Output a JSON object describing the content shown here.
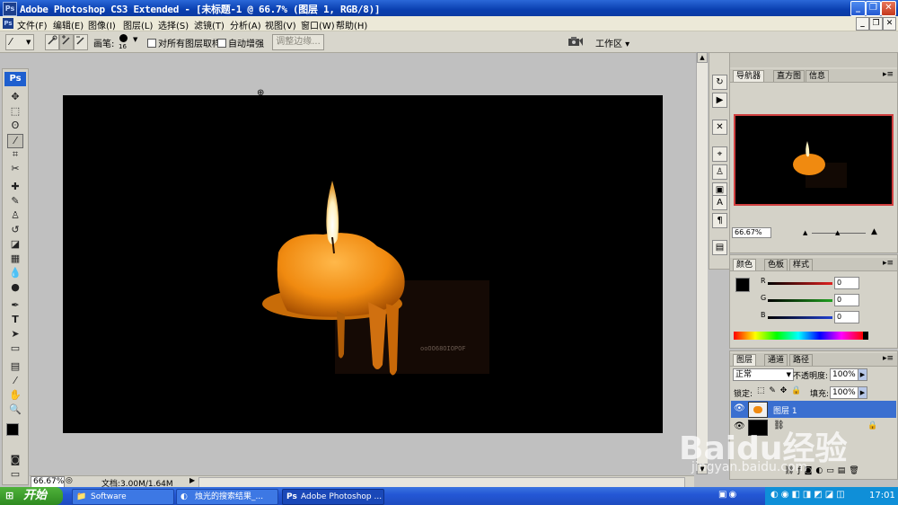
{
  "window": {
    "title": "Adobe Photoshop CS3 Extended - [未标题-1 @ 66.7% (图层 1, RGB/8)]",
    "app_icon": "Ps",
    "buttons": {
      "minimize": "_",
      "restore": "❐",
      "close": "✕"
    }
  },
  "menu": {
    "items": [
      "文件(F)",
      "编辑(E)",
      "图像(I)",
      "图层(L)",
      "选择(S)",
      "滤镜(T)",
      "分析(A)",
      "视图(V)",
      "窗口(W)",
      "帮助(H)"
    ],
    "doc_buttons": {
      "minimize": "_",
      "restore": "❐",
      "close": "✕"
    }
  },
  "options": {
    "brush_label": "画笔:",
    "brush_size": "16",
    "sample_all_layers": "对所有图层取样",
    "auto_enhance": "自动增强",
    "refine_edge": "调整边缘...",
    "workspace": "工作区 ▾"
  },
  "toolbox": {
    "logo": "Ps",
    "tools": [
      "move",
      "marquee",
      "lasso",
      "quick-selection",
      "crop",
      "slice",
      "healing",
      "brush",
      "stamp",
      "history-brush",
      "eraser",
      "gradient",
      "blur",
      "dodge",
      "pen",
      "type",
      "path-select",
      "shape",
      "notes",
      "eyedropper",
      "hand",
      "zoom"
    ],
    "selected_tool": "quick-selection"
  },
  "canvas": {
    "watermark_text": "Baidu经验",
    "watermark_sub": "jingyan.baidu.com"
  },
  "status": {
    "zoom": "66.67%",
    "doc_info": "文档:3.00M/1.64M"
  },
  "navigator": {
    "tabs": [
      "导航器",
      "直方图",
      "信息"
    ],
    "zoom": "66.67%"
  },
  "color_panel": {
    "tabs": [
      "颜色",
      "色板",
      "样式"
    ],
    "channels": [
      {
        "label": "R",
        "value": "0",
        "color": "#e02020"
      },
      {
        "label": "G",
        "value": "0",
        "color": "#20a020"
      },
      {
        "label": "B",
        "value": "0",
        "color": "#2040d0"
      }
    ]
  },
  "layers_panel": {
    "tabs": [
      "图层",
      "通道",
      "路径"
    ],
    "blend_mode": "正常",
    "opacity_label": "不透明度:",
    "opacity": "100%",
    "lock_label": "锁定:",
    "fill_label": "填充:",
    "fill": "100%",
    "layers": [
      {
        "name": "图层 1",
        "selected": true
      },
      {
        "name": "",
        "selected": false
      }
    ]
  },
  "taskbar": {
    "start": "开始",
    "items": [
      "Software",
      "烛光的搜索结果_...",
      "Adobe Photoshop ..."
    ],
    "time": "17:01"
  },
  "colors": {
    "title_blue": "#0a3fb0",
    "taskbar_blue": "#2458d6",
    "start_green": "#3a9a2a",
    "layer_selected": "#3a6fd0"
  }
}
